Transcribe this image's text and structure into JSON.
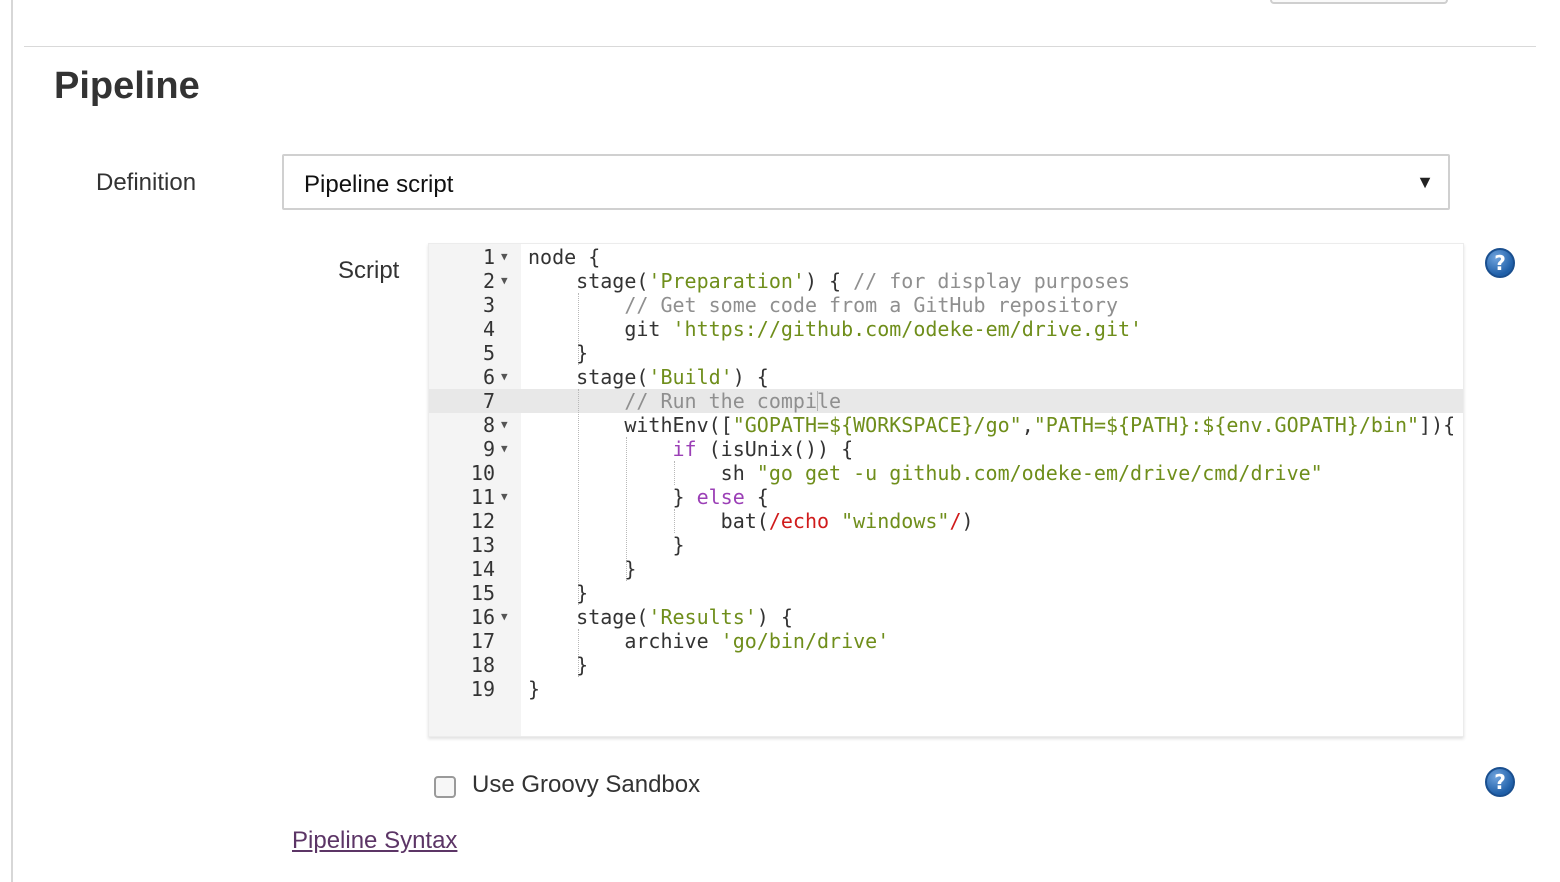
{
  "section": {
    "title": "Pipeline"
  },
  "definition": {
    "label": "Definition",
    "selected": "Pipeline script"
  },
  "script": {
    "label": "Script",
    "active_line": 7,
    "lines": [
      {
        "n": "1",
        "fold": true,
        "segs": [
          [
            "p",
            "node {"
          ]
        ]
      },
      {
        "n": "2",
        "fold": true,
        "segs": [
          [
            "p",
            "    stage("
          ],
          [
            "s",
            "'Preparation'"
          ],
          [
            "p",
            ") { "
          ],
          [
            "c",
            "// for display purposes"
          ]
        ]
      },
      {
        "n": "3",
        "fold": false,
        "segs": [
          [
            "c",
            "        // Get some code from a GitHub repository"
          ]
        ]
      },
      {
        "n": "4",
        "fold": false,
        "segs": [
          [
            "p",
            "        git "
          ],
          [
            "s",
            "'https://github.com/odeke-em/drive.git'"
          ]
        ]
      },
      {
        "n": "5",
        "fold": false,
        "segs": [
          [
            "p",
            "    }"
          ]
        ]
      },
      {
        "n": "6",
        "fold": true,
        "segs": [
          [
            "p",
            "    stage("
          ],
          [
            "s",
            "'Build'"
          ],
          [
            "p",
            ") {"
          ]
        ]
      },
      {
        "n": "7",
        "fold": false,
        "segs": [
          [
            "c",
            "        // Run the compile"
          ]
        ]
      },
      {
        "n": "8",
        "fold": true,
        "segs": [
          [
            "p",
            "        withEnv(["
          ],
          [
            "s",
            "\"GOPATH=${WORKSPACE}/go\""
          ],
          [
            "p",
            ","
          ],
          [
            "s",
            "\"PATH=${PATH}:${env.GOPATH}/bin\""
          ],
          [
            "p",
            "]){"
          ]
        ]
      },
      {
        "n": "9",
        "fold": true,
        "segs": [
          [
            "p",
            "            "
          ],
          [
            "k",
            "if"
          ],
          [
            "p",
            " (isUnix()) {"
          ]
        ]
      },
      {
        "n": "10",
        "fold": false,
        "segs": [
          [
            "p",
            "                sh "
          ],
          [
            "s",
            "\"go get -u github.com/odeke-em/drive/cmd/drive\""
          ]
        ]
      },
      {
        "n": "11",
        "fold": true,
        "segs": [
          [
            "p",
            "            } "
          ],
          [
            "k",
            "else"
          ],
          [
            "p",
            " {"
          ]
        ]
      },
      {
        "n": "12",
        "fold": false,
        "segs": [
          [
            "p",
            "                bat("
          ],
          [
            "r",
            "/echo "
          ],
          [
            "s",
            "\"windows\""
          ],
          [
            "r",
            "/"
          ],
          [
            "p",
            ")"
          ]
        ]
      },
      {
        "n": "13",
        "fold": false,
        "segs": [
          [
            "p",
            "            }"
          ]
        ]
      },
      {
        "n": "14",
        "fold": false,
        "segs": [
          [
            "p",
            "        }"
          ]
        ]
      },
      {
        "n": "15",
        "fold": false,
        "segs": [
          [
            "p",
            "    }"
          ]
        ]
      },
      {
        "n": "16",
        "fold": true,
        "segs": [
          [
            "p",
            "    stage("
          ],
          [
            "s",
            "'Results'"
          ],
          [
            "p",
            ") {"
          ]
        ]
      },
      {
        "n": "17",
        "fold": false,
        "segs": [
          [
            "p",
            "        archive "
          ],
          [
            "s",
            "'go/bin/drive'"
          ]
        ]
      },
      {
        "n": "18",
        "fold": false,
        "segs": [
          [
            "p",
            "    }"
          ]
        ]
      },
      {
        "n": "19",
        "fold": false,
        "segs": [
          [
            "p",
            "}"
          ]
        ]
      }
    ]
  },
  "help_icon": {
    "glyph": "?"
  },
  "sandbox": {
    "label": "Use Groovy Sandbox",
    "checked": false
  },
  "syntax_link": {
    "label": "Pipeline Syntax"
  },
  "colors": {
    "string": "#6f8e1b",
    "comment": "#8f8f8f",
    "keyword": "#9b3fb6",
    "regex": "#d01b1b",
    "link": "#5c3566"
  }
}
